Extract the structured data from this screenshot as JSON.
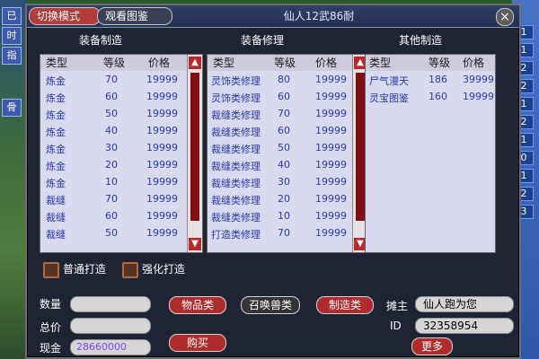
{
  "window": {
    "tabs": [
      {
        "label": "切换模式"
      },
      {
        "label": "观看图鉴"
      }
    ],
    "title": "仙人12武86耐",
    "close_label": "×"
  },
  "sections": {
    "equip_make": "装备制造",
    "equip_repair": "装备修理",
    "other_make": "其他制造"
  },
  "tables": {
    "headers": {
      "col1": "类型",
      "col2": "等级",
      "col3": "价格"
    },
    "equip_make": [
      {
        "type": "炼金",
        "level": "70",
        "price": "19999"
      },
      {
        "type": "炼金",
        "level": "60",
        "price": "19999"
      },
      {
        "type": "炼金",
        "level": "50",
        "price": "19999"
      },
      {
        "type": "炼金",
        "level": "40",
        "price": "19999"
      },
      {
        "type": "炼金",
        "level": "30",
        "price": "19999"
      },
      {
        "type": "炼金",
        "level": "20",
        "price": "19999"
      },
      {
        "type": "炼金",
        "level": "10",
        "price": "19999"
      },
      {
        "type": "裁缝",
        "level": "70",
        "price": "19999"
      },
      {
        "type": "裁缝",
        "level": "60",
        "price": "19999"
      },
      {
        "type": "裁缝",
        "level": "50",
        "price": "19999"
      }
    ],
    "equip_repair": [
      {
        "type": "灵饰类修理",
        "level": "80",
        "price": "19999"
      },
      {
        "type": "灵饰类修理",
        "level": "60",
        "price": "19999"
      },
      {
        "type": "裁缝类修理",
        "level": "70",
        "price": "19999"
      },
      {
        "type": "裁缝类修理",
        "level": "60",
        "price": "19999"
      },
      {
        "type": "裁缝类修理",
        "level": "50",
        "price": "19999"
      },
      {
        "type": "裁缝类修理",
        "level": "40",
        "price": "19999"
      },
      {
        "type": "裁缝类修理",
        "level": "30",
        "price": "19999"
      },
      {
        "type": "裁缝类修理",
        "level": "20",
        "price": "19999"
      },
      {
        "type": "裁缝类修理",
        "level": "10",
        "price": "19999"
      },
      {
        "type": "打造类修理",
        "level": "70",
        "price": "19999"
      }
    ],
    "other_make": [
      {
        "type": "尸气漫天",
        "level": "186",
        "price": "39999"
      },
      {
        "type": "灵宝图鉴",
        "level": "160",
        "price": "19999"
      }
    ]
  },
  "options": {
    "normal": "普通打造",
    "strong": "强化打造"
  },
  "form": {
    "quantity_label": "数量",
    "total_label": "总价",
    "cash_label": "现金",
    "quantity_value": "",
    "total_value": "",
    "cash_value": "28660000"
  },
  "buttons": {
    "items": "物品类",
    "pets": "召唤兽类",
    "make": "制造类",
    "buy": "购买",
    "more": "更多"
  },
  "seller": {
    "owner_label": "摊主",
    "owner_value": "仙人跑为您",
    "id_label": "ID",
    "id_value": "32358954"
  },
  "sidebars": {
    "right_numbers": [
      "1",
      "1",
      "2",
      "2",
      "1",
      "2",
      "1",
      "0",
      "1",
      "2",
      "3"
    ],
    "left_tags": [
      "已",
      "时",
      "指",
      "骨"
    ]
  }
}
